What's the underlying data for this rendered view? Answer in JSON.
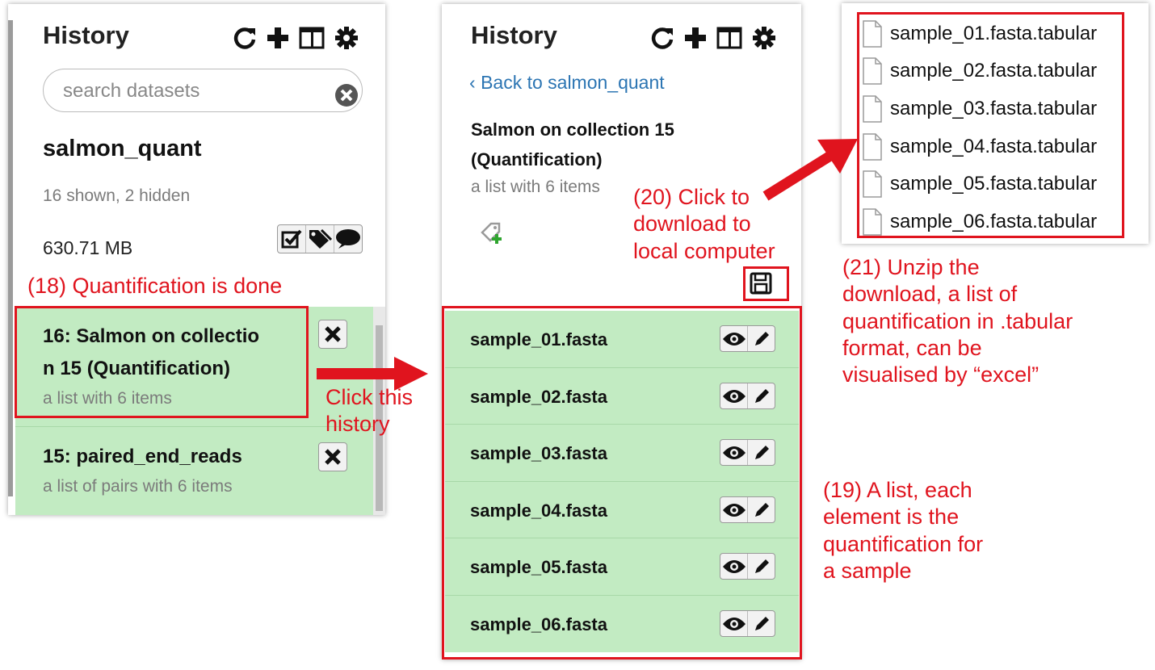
{
  "left_panel": {
    "title": "History",
    "search_placeholder": "search datasets",
    "history_name": "salmon_quant",
    "shown_hidden": "16 shown, 2 hidden",
    "size": "630.71 MB",
    "items": [
      {
        "title_line1": "16: Salmon on collectio",
        "title_line2": "n 15 (Quantification)",
        "subtitle": "a list with 6 items"
      },
      {
        "title_line1": "15: paired_end_reads",
        "subtitle": "a list of pairs with 6 items"
      }
    ]
  },
  "middle_panel": {
    "title": "History",
    "back_link": "Back to salmon_quant",
    "collection_title": "Salmon on collection 15 (Quantification)",
    "collection_subtitle": "a list with 6 items",
    "elements": [
      "sample_01.fasta",
      "sample_02.fasta",
      "sample_03.fasta",
      "sample_04.fasta",
      "sample_05.fasta",
      "sample_06.fasta"
    ]
  },
  "file_list": [
    "sample_01.fasta.tabular",
    "sample_02.fasta.tabular",
    "sample_03.fasta.tabular",
    "sample_04.fasta.tabular",
    "sample_05.fasta.tabular",
    "sample_06.fasta.tabular"
  ],
  "annotations": {
    "a18": "(18) Quantification is done",
    "click_line1": "Click this",
    "click_line2": "history",
    "a20_line1": "(20) Click to",
    "a20_line2": "download to",
    "a20_line3": "local computer",
    "a21_line1": "(21) Unzip the",
    "a21_line2": "download, a list of",
    "a21_line3": "quantification in .tabular",
    "a21_line4": "format, can be",
    "a21_line5": "visualised by “excel”",
    "a19_line1": "(19) A list, each",
    "a19_line2": "element is the",
    "a19_line3": "quantification for",
    "a19_line4": "a sample"
  },
  "colors": {
    "annotation_red": "#e0141e",
    "item_green": "#c2ebc2",
    "link_blue": "#2c75b3"
  },
  "icons": [
    "refresh-icon",
    "plus-icon",
    "columns-icon",
    "gear-icon",
    "clear-search-icon",
    "check-square-icon",
    "tags-icon",
    "comment-icon",
    "close-icon",
    "eye-icon",
    "pencil-icon",
    "tag-add-icon",
    "save-icon",
    "file-icon",
    "chevron-left-icon"
  ]
}
